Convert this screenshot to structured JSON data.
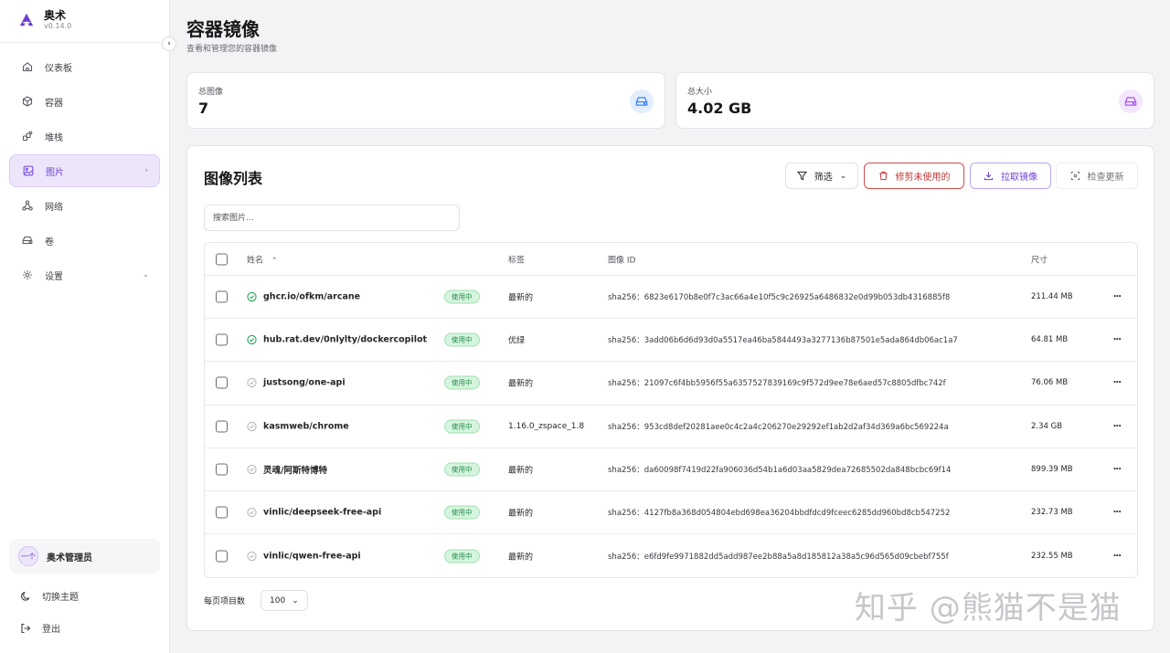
{
  "app": {
    "name": "奥术",
    "version": "v0.14.0"
  },
  "sidebar": {
    "items": [
      {
        "label": "仪表板",
        "icon": "house-icon"
      },
      {
        "label": "容器",
        "icon": "box-icon"
      },
      {
        "label": "堆栈",
        "icon": "stack-icon"
      },
      {
        "label": "图片",
        "icon": "image-icon",
        "active": true
      },
      {
        "label": "网络",
        "icon": "network-icon"
      },
      {
        "label": "卷",
        "icon": "drive-icon"
      },
      {
        "label": "设置",
        "icon": "gear-icon"
      }
    ],
    "user": {
      "name": "奥术管理员",
      "avatar": "一个"
    },
    "theme_label": "切换主题",
    "logout_label": "登出"
  },
  "page": {
    "title": "容器镜像",
    "subtitle": "查看和管理您的容器镜像"
  },
  "stats": [
    {
      "label": "总图像",
      "value": "7",
      "icon": "drive-icon",
      "color": "#3b82f6"
    },
    {
      "label": "总大小",
      "value": "4.02 GB",
      "icon": "drive-icon",
      "color": "#a855f7"
    }
  ],
  "list": {
    "title": "图像列表",
    "filter_label": "筛选",
    "prune_label": "修剪未使用的",
    "pull_label": "拉取镜像",
    "check_label": "检查更新",
    "search_placeholder": "搜索图片...",
    "columns": {
      "name": "姓名",
      "tag": "标签",
      "id": "图像 ID",
      "size": "尺寸"
    },
    "rows": [
      {
        "name": "ghcr.io/ofkm/arcane",
        "in_use": true,
        "status": "使用中",
        "tag": "最新的",
        "id": "sha256：6823e6170b8e0f7c3ac66a4e10f5c9c26925a6486832e0d99b053db4316885f8",
        "size": "211.44 MB"
      },
      {
        "name": "hub.rat.dev/0nlylty/dockercopilot",
        "in_use": true,
        "status": "使用中",
        "tag": "优绿",
        "id": "sha256：3add06b6d6d93d0a5517ea46ba5844493a3277136b87501e5ada864db06ac1a7",
        "size": "64.81 MB"
      },
      {
        "name": "justsong/one-api",
        "in_use": false,
        "status": "使用中",
        "tag": "最新的",
        "id": "sha256：21097c6f4bb5956f55a6357527839169c9f572d9ee78e6aed57c8805dfbc742f",
        "size": "76.06 MB"
      },
      {
        "name": "kasmweb/chrome",
        "in_use": false,
        "status": "使用中",
        "tag": "1.16.0_zspace_1.8",
        "id": "sha256：953cd8def20281aee0c4c2a4c206270e29292ef1ab2d2af34d369a6bc569224a",
        "size": "2.34 GB"
      },
      {
        "name": "灵魂/阿斯特博特",
        "in_use": false,
        "status": "使用中",
        "tag": "最新的",
        "id": "sha256：da60098f7419d22fa906036d54b1a6d03aa5829dea72685502da848bcbc69f14",
        "size": "899.39 MB"
      },
      {
        "name": "vinlic/deepseek-free-api",
        "in_use": false,
        "status": "使用中",
        "tag": "最新的",
        "id": "sha256：4127fb8a368d054804ebd698ea36204bbdfdcd9fceec6285dd960bd8cb547252",
        "size": "232.73 MB"
      },
      {
        "name": "vinlic/qwen-free-api",
        "in_use": false,
        "status": "使用中",
        "tag": "最新的",
        "id": "sha256：e6fd9fe9971882dd5add987ee2b88a5a8d185812a38a5c96d565d09cbebf755f",
        "size": "232.55 MB"
      }
    ],
    "per_page_label": "每页项目数",
    "per_page_value": "100"
  },
  "watermark": "知乎 @熊猫不是猫"
}
